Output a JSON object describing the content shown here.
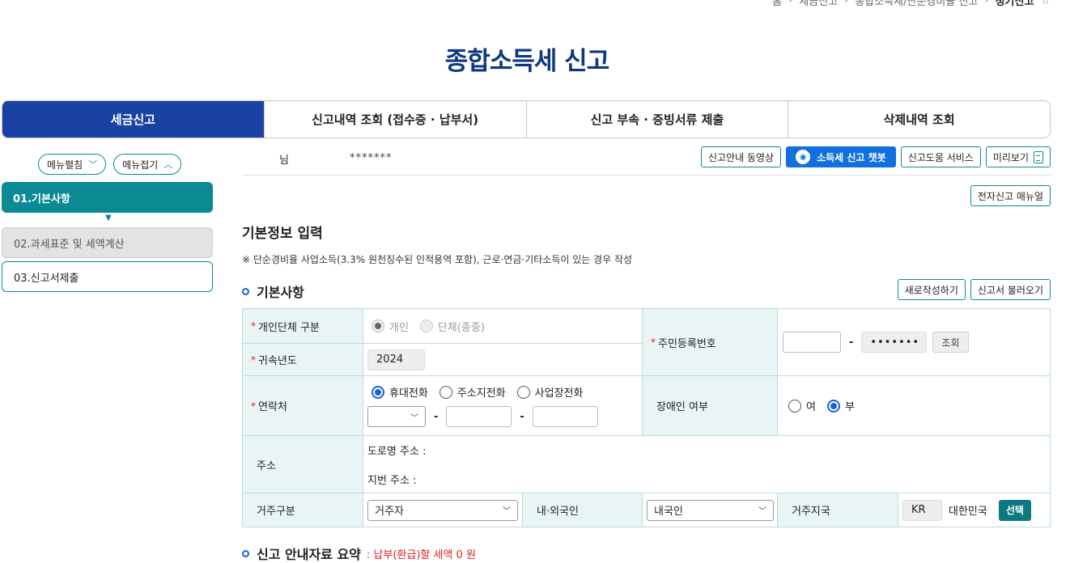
{
  "breadcrumb": {
    "items": [
      "홈",
      "세금신고",
      "종합소득세/단순경비율 신고",
      "정기신고"
    ]
  },
  "page_title": "종합소득세 신고",
  "tabs": [
    {
      "label": "세금신고",
      "active": true
    },
    {
      "label": "신고내역 조회 (접수증 · 납부서)",
      "active": false
    },
    {
      "label": "신고 부속 · 증빙서류 제출",
      "active": false
    },
    {
      "label": "삭제내역 조회",
      "active": false
    }
  ],
  "sidebar": {
    "expand_label": "메뉴펼침",
    "collapse_label": "메뉴접기",
    "steps": [
      {
        "label": "01.기본사항",
        "state": "active"
      },
      {
        "label": "02.과세표준 및 세액계산",
        "state": "disabled"
      },
      {
        "label": "03.신고서제출",
        "state": "normal"
      }
    ]
  },
  "user": {
    "name_suffix": "님",
    "masked_id": "*******"
  },
  "toolbar": {
    "video_guide": "신고안내 동영상",
    "chatbot": "소득세 신고 챗봇",
    "help_service": "신고도움 서비스",
    "preview": "미리보기",
    "manual": "전자신고 매뉴얼"
  },
  "section": {
    "heading": "기본정보 입력",
    "note": "※ 단순경비율 사업소득(3.3% 원천징수된 인적용역 포함), 근로·연금·기타소득이 있는 경우 작성",
    "basic_title": "기본사항",
    "new_write": "새로작성하기",
    "load_form": "신고서 불러오기",
    "summary_title": "신고 안내자료 요약",
    "summary_note": ": 납부(환급)할 세액 0 원"
  },
  "form": {
    "required_mark": "*",
    "type_label": "개인단체 구분",
    "type_options": [
      "개인",
      "단체(종중)"
    ],
    "year_label": "귀속년도",
    "year_value": "2024",
    "rrn_label": "주민등록번호",
    "rrn_back_masked": "•••••••",
    "rrn_lookup": "조회",
    "contact_label": "연락처",
    "contact_options": [
      "휴대전화",
      "주소지전화",
      "사업장전화"
    ],
    "disabled_label": "장애인 여부",
    "disabled_options": [
      "여",
      "부"
    ],
    "address_label": "주소",
    "road_address": "도로명 주소 :",
    "lot_address": "지번 주소 :",
    "residence_label": "거주구분",
    "residence_value": "거주자",
    "nationality_label": "내·외국인",
    "nationality_value": "내국인",
    "country_label": "거주지국",
    "country_code": "KR",
    "country_name": "대한민국",
    "select_btn": "선택"
  },
  "colors": {
    "primary_blue": "#1a42a4",
    "teal": "#0b8a94",
    "title_navy": "#0b3880",
    "required_red": "#e02020"
  }
}
